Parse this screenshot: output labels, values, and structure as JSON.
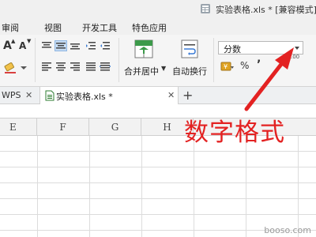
{
  "titlebar": {
    "title": "实验表格.xls * [兼容模式]"
  },
  "ribbon_tabs": [
    "审阅",
    "视图",
    "开发工具",
    "特色应用"
  ],
  "ribbon": {
    "font_grow": "A",
    "font_shrink": "A",
    "merge_center_label": "合并居中",
    "wrap_text_label": "自动换行",
    "number_format": {
      "value": "分数"
    },
    "percent_label": "%",
    "comma_label": "’",
    "decimal_label": ".00"
  },
  "doc_tabs": {
    "wps_label": "WPS",
    "file_label": "实验表格.xls *",
    "close_glyph": "✕",
    "add_glyph": "+"
  },
  "columns": [
    "E",
    "F",
    "G",
    "H"
  ],
  "annotation": {
    "text": "数字格式"
  },
  "watermark": "booso.com",
  "colors": {
    "accent": "#2e7d32",
    "annotation": "#e32222"
  }
}
